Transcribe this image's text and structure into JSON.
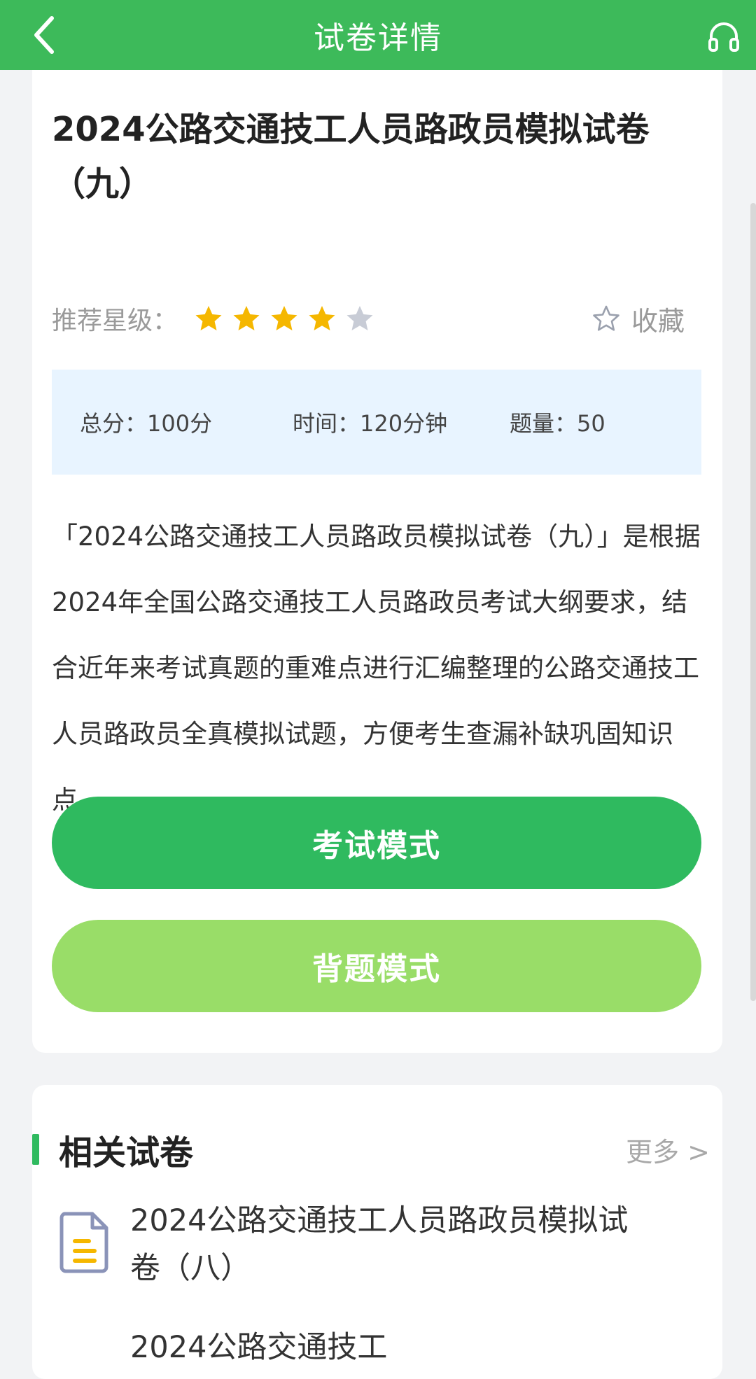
{
  "header": {
    "title": "试卷详情"
  },
  "paper": {
    "title": "2024公路交通技工人员路政员模拟试卷（九）",
    "rating_label": "推荐星级：",
    "rating": 4,
    "rating_max": 5,
    "favorite_label": "收藏",
    "stats": {
      "total_score": "总分：100分",
      "time": "时间：120分钟",
      "count": "题量：50"
    },
    "description": "「2024公路交通技工人员路政员模拟试卷（九）」是根据2024年全国公路交通技工人员路政员考试大纲要求，结合近年来考试真题的重难点进行汇编整理的公路交通技工人员路政员全真模拟试题，方便考生查漏补缺巩固知识点。",
    "exam_button": "考试模式",
    "recite_button": "背题模式"
  },
  "related": {
    "title": "相关试卷",
    "more": "更多 >",
    "items": [
      {
        "title": "2024公路交通技工人员路政员模拟试卷（八）"
      },
      {
        "title": "2024公路交通技工"
      }
    ]
  },
  "colors": {
    "primary": "#3dba5a",
    "button_primary": "#2fba5f",
    "button_secondary": "#99dd68",
    "star_on": "#f5b700",
    "star_off": "#c8ccd6",
    "stats_bg": "#e8f4ff"
  },
  "icons": {
    "back": "chevron-left-icon",
    "support": "headset-icon",
    "favorite": "star-outline-icon",
    "document": "document-icon"
  }
}
